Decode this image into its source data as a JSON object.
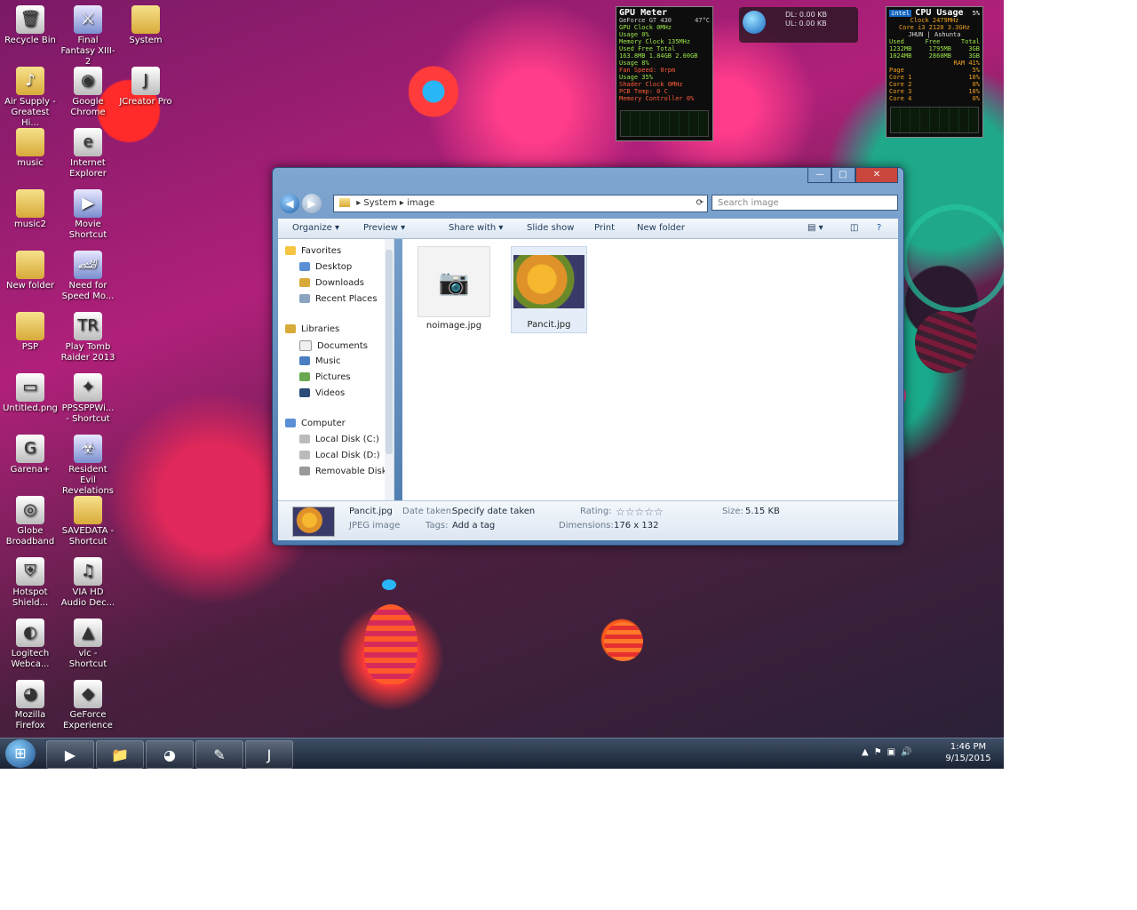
{
  "desktop_icons": [
    {
      "label": "Recycle Bin",
      "icon": "recycle-bin-icon",
      "glyph": "🗑"
    },
    {
      "label": "Final Fantasy XIII-2",
      "icon": "game-shortcut-icon",
      "glyph": "⚔"
    },
    {
      "label": "System",
      "icon": "folder-icon",
      "glyph": ""
    },
    {
      "label": "Air Supply - Greatest Hi...",
      "icon": "music-folder-icon",
      "glyph": "♪"
    },
    {
      "label": "Google Chrome",
      "icon": "chrome-icon",
      "glyph": "◉"
    },
    {
      "label": "JCreator Pro",
      "icon": "jcreator-icon",
      "glyph": "J"
    },
    {
      "label": "music",
      "icon": "folder-icon",
      "glyph": ""
    },
    {
      "label": "Internet Explorer",
      "icon": "internet-explorer-icon",
      "glyph": "e"
    },
    {
      "label": "music2",
      "icon": "folder-icon",
      "glyph": ""
    },
    {
      "label": "Movie Shortcut",
      "icon": "movie-shortcut-icon",
      "glyph": "▶"
    },
    {
      "label": "New folder",
      "icon": "folder-icon",
      "glyph": ""
    },
    {
      "label": "Need for Speed Mo...",
      "icon": "game-shortcut-icon",
      "glyph": "🏎"
    },
    {
      "label": "PSP",
      "icon": "folder-icon",
      "glyph": ""
    },
    {
      "label": "Play Tomb Raider 2013",
      "icon": "tomb-raider-icon",
      "glyph": "TR"
    },
    {
      "label": "Untitled.png",
      "icon": "image-file-icon",
      "glyph": "▭"
    },
    {
      "label": "PPSSPPWi... - Shortcut",
      "icon": "ppsspp-icon",
      "glyph": "✦"
    },
    {
      "label": "Garena+",
      "icon": "garena-icon",
      "glyph": "G"
    },
    {
      "label": "Resident Evil Revelations 2",
      "icon": "game-shortcut-icon",
      "glyph": "☣"
    },
    {
      "label": "Globe Broadband",
      "icon": "globe-broadband-icon",
      "glyph": "◎"
    },
    {
      "label": "SAVEDATA - Shortcut",
      "icon": "folder-shortcut-icon",
      "glyph": ""
    },
    {
      "label": "Hotspot Shield...",
      "icon": "hotspot-shield-icon",
      "glyph": "⛨"
    },
    {
      "label": "VIA HD Audio Dec...",
      "icon": "via-audio-icon",
      "glyph": "♫"
    },
    {
      "label": "Logitech Webca...",
      "icon": "webcam-icon",
      "glyph": "◐"
    },
    {
      "label": "vlc - Shortcut",
      "icon": "vlc-icon",
      "glyph": "▲"
    },
    {
      "label": "Mozilla Firefox",
      "icon": "firefox-icon",
      "glyph": "◕"
    },
    {
      "label": "GeForce Experience",
      "icon": "geforce-icon",
      "glyph": "◆"
    }
  ],
  "gpu_gadget": {
    "title": "GPU Meter",
    "model": "GeForce GT 430",
    "temp": "47°C",
    "lines": [
      "GPU Clock 0MHz",
      "Usage 0%",
      "Memory Clock 135MHz",
      "Used   Free   Total",
      "163.8MB  1.84GB  2.00GB",
      "Usage 8%",
      "Fan Speed: 0rpm",
      "Usage 35%",
      "Shader Clock 0MHz",
      "PCB Temp: 0 C",
      "Memory Controller 0%"
    ]
  },
  "net_gadget": {
    "dl": "DL: 0.00 KB",
    "ul": "UL: 0.00 KB"
  },
  "cpu_gadget": {
    "title": "CPU Usage",
    "percent": "5%",
    "clock": "Clock 2479MHz",
    "core": "Core i3  2120 3.3GHz",
    "user": "JHUN | Ashunta",
    "mem_headers": [
      "Used",
      "Free",
      "Total"
    ],
    "mem_row1": [
      "1232MB",
      "1795MB",
      "3GB"
    ],
    "mem_row2": [
      "1024MB",
      "2860MB",
      "3GB"
    ],
    "ram": "RAM  41%",
    "rows": [
      {
        "label": "Page",
        "value": "5%"
      },
      {
        "label": "Core 1",
        "value": "10%"
      },
      {
        "label": "Core 2",
        "value": "0%"
      },
      {
        "label": "Core 3",
        "value": "10%"
      },
      {
        "label": "Core 4",
        "value": "0%"
      }
    ]
  },
  "explorer": {
    "window_buttons": {
      "minimize": "—",
      "maximize": "□",
      "close": "✕"
    },
    "breadcrumb": [
      "System",
      "image"
    ],
    "search_placeholder": "Search image",
    "commands": [
      "Organize ▾",
      "Preview ▾",
      "Share with ▾",
      "Slide show",
      "Print",
      "New folder"
    ],
    "nav": {
      "favorites_header": "Favorites",
      "favorites": [
        "Desktop",
        "Downloads",
        "Recent Places"
      ],
      "libraries_header": "Libraries",
      "libraries": [
        "Documents",
        "Music",
        "Pictures",
        "Videos"
      ],
      "computer_header": "Computer",
      "computer": [
        "Local Disk (C:)",
        "Local Disk (D:)",
        "Removable Disk ("
      ]
    },
    "files": [
      {
        "name": "noimage.jpg"
      },
      {
        "name": "Pancit.jpg"
      }
    ],
    "details": {
      "filename": "Pancit.jpg",
      "filetype": "JPEG image",
      "date_label": "Date taken:",
      "date_value": "Specify date taken",
      "tags_label": "Tags:",
      "tags_value": "Add a tag",
      "rating_label": "Rating:",
      "rating_stars": "☆☆☆☆☆",
      "dimensions_label": "Dimensions:",
      "dimensions_value": "176 x 132",
      "size_label": "Size:",
      "size_value": "5.15 KB"
    }
  },
  "taskbar": {
    "start_glyph": "⊞",
    "apps": [
      {
        "name": "media-player",
        "glyph": "▶"
      },
      {
        "name": "explorer",
        "glyph": "📁"
      },
      {
        "name": "firefox",
        "glyph": "◕"
      },
      {
        "name": "jcreator-pro",
        "glyph": "✎"
      },
      {
        "name": "jcreator",
        "glyph": "J"
      }
    ],
    "clock_time": "1:46 PM",
    "clock_date": "9/15/2015",
    "tray": [
      "▲",
      "⚑",
      "▣",
      "🔊"
    ]
  }
}
